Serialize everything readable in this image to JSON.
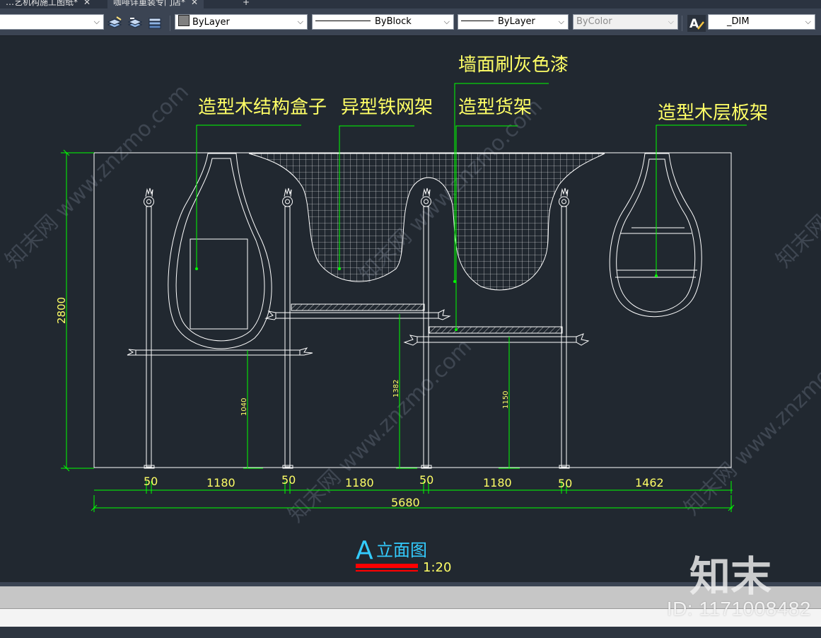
{
  "tabs": [
    {
      "label": "…艺机构施工图纸*",
      "close": "✕"
    },
    {
      "label": "咖啡详重装专门店*",
      "close": "✕"
    },
    {
      "label": "+"
    }
  ],
  "toolbar": {
    "layer_combo": "",
    "color_combo": "ByLayer",
    "linetype_combo": "ByBlock",
    "lineweight_combo": "ByLayer",
    "plotstyle_combo": "ByColor",
    "dimstyle_combo": "_DIM",
    "icons": [
      "layer-match-icon",
      "layer-previous-icon",
      "layer-states-icon",
      "text-style-icon"
    ]
  },
  "drawing": {
    "callouts": {
      "wall_paint": "墙面刷灰色漆",
      "wood_box": "造型木结构盒子",
      "iron_mesh": "异型铁网架",
      "shelf": "造型货架",
      "wood_shelf": "造型木层板架"
    },
    "dimensions": {
      "height": "2800",
      "h1": "1040",
      "h2": "1382",
      "h3": "1150",
      "bottom": [
        "50",
        "1180",
        "50",
        "1180",
        "50",
        "1180",
        "50",
        "1462"
      ],
      "total": "5680"
    },
    "title_letter": "A",
    "title_text": "立面图",
    "scale": "1:20",
    "colors": {
      "background": "#212830",
      "geometry": "#ffffff",
      "dimension": "#00ff00",
      "callout_text": "#ffff66",
      "title": "#33ccff",
      "title_bar": "#ff0000"
    }
  },
  "watermark": {
    "text": "知末网 www.znzmo.com",
    "logo": "知末",
    "id": "ID: 1171008482"
  }
}
